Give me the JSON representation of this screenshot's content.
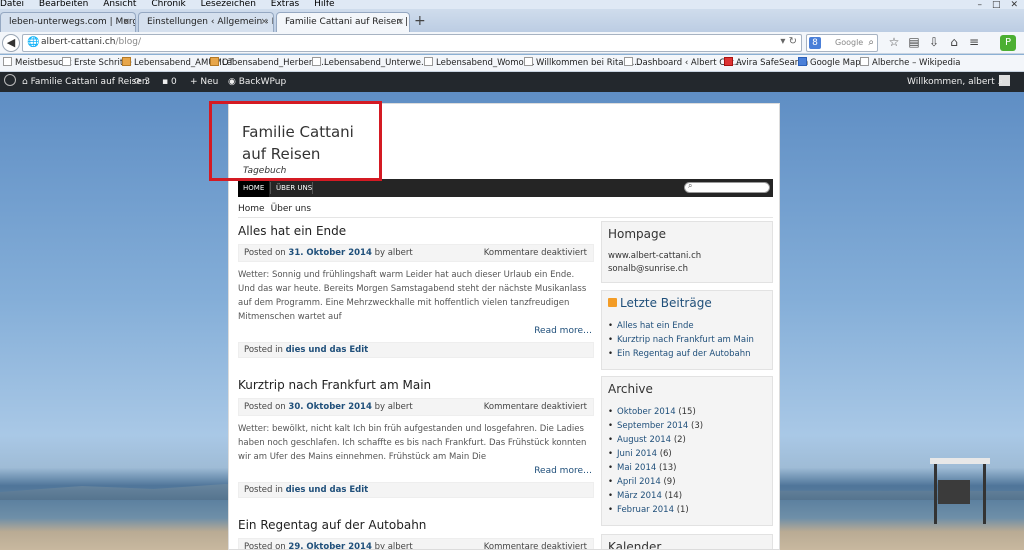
{
  "browser": {
    "menu": [
      "Datei",
      "Bearbeiten",
      "Ansicht",
      "Chronik",
      "Lesezeichen",
      "Extras",
      "Hilfe"
    ],
    "tabs": [
      {
        "label": "leben-unterwegs.com | Morge..."
      },
      {
        "label": "Einstellungen ‹ Allgemein ‹ Fa..."
      },
      {
        "label": "Familie Cattani auf Reisen | Tag..."
      }
    ],
    "url_host": "albert-cattani.ch",
    "url_path": "/blog/",
    "search_placeholder": "Google",
    "bookmarks": [
      "Meistbesucht",
      "Erste Schritte",
      "Lebensabend_AMUMOT",
      "Lebensabend_Herbert ...",
      "Lebensabend_Unterwe...",
      "Lebensabend_Womo,...",
      "Willkommen bei Rita u...",
      "Dashboard ‹ Albert Cat...",
      "Avira SafeSearch",
      "Google Maps",
      "Alberche – Wikipedia"
    ]
  },
  "adminbar": {
    "site": "Familie Cattani auf Reisen",
    "updates": "3",
    "comments": "0",
    "new": "Neu",
    "plugin": "BackWPup",
    "greeting": "Willkommen, albert"
  },
  "blog": {
    "title": "Familie Cattani auf Reisen",
    "tagline": "Tagebuch",
    "nav": [
      "HOME",
      "ÜBER UNS"
    ],
    "subnav": [
      "Home",
      "Über uns"
    ]
  },
  "posts": [
    {
      "title": "Alles hat ein Ende",
      "posted_on": "Posted on",
      "date": "31. Oktober 2014",
      "by": "by",
      "author": "albert",
      "comments": "Kommentare deaktiviert",
      "excerpt": "Wetter: Sonnig und frühlingshaft warm Leider hat auch dieser Urlaub ein Ende. Und das war heute. Bereits Morgen Samstagabend steht der nächste Musikanlass auf dem Programm. Eine Mehrzweckhalle mit hoffentlich vielen tanzfreudigen Mitmenschen wartet auf",
      "readmore": "Read more…",
      "posted_in": "Posted in",
      "category": "dies und das Edit"
    },
    {
      "title": "Kurztrip nach Frankfurt am Main",
      "posted_on": "Posted on",
      "date": "30. Oktober 2014",
      "by": "by",
      "author": "albert",
      "comments": "Kommentare deaktiviert",
      "excerpt": "Wetter: bewölkt, nicht kalt Ich bin früh aufgestanden und losgefahren. Die Ladies haben noch geschlafen. Ich schaffte es bis nach Frankfurt. Das Frühstück konnten wir am Ufer des Mains einnehmen. Frühstück am Main   Die",
      "readmore": "Read more…",
      "posted_in": "Posted in",
      "category": "dies und das Edit"
    },
    {
      "title": "Ein Regentag auf der Autobahn",
      "posted_on": "Posted on",
      "date": "29. Oktober 2014",
      "by": "by",
      "author": "albert",
      "comments": "Kommentare deaktiviert"
    }
  ],
  "sidebar": {
    "hompage": {
      "title": "Hompage",
      "lines": [
        "www.albert-cattani.ch",
        "sonalb@sunrise.ch"
      ]
    },
    "recent": {
      "title": "Letzte Beiträge",
      "items": [
        "Alles hat ein Ende",
        "Kurztrip nach Frankfurt am Main",
        "Ein Regentag auf der Autobahn"
      ]
    },
    "archive": {
      "title": "Archive",
      "items": [
        {
          "label": "Oktober 2014",
          "count": "(15)"
        },
        {
          "label": "September 2014",
          "count": "(3)"
        },
        {
          "label": "August 2014",
          "count": "(2)"
        },
        {
          "label": "Juni 2014",
          "count": "(6)"
        },
        {
          "label": "Mai 2014",
          "count": "(13)"
        },
        {
          "label": "April 2014",
          "count": "(9)"
        },
        {
          "label": "März 2014",
          "count": "(14)"
        },
        {
          "label": "Februar 2014",
          "count": "(1)"
        }
      ]
    },
    "calendar": {
      "title": "Kalender"
    }
  },
  "colors": {
    "highlight_box": "#d41a23",
    "link": "#1f4f7a",
    "adminbar": "#23282d",
    "nav": "#252525"
  }
}
